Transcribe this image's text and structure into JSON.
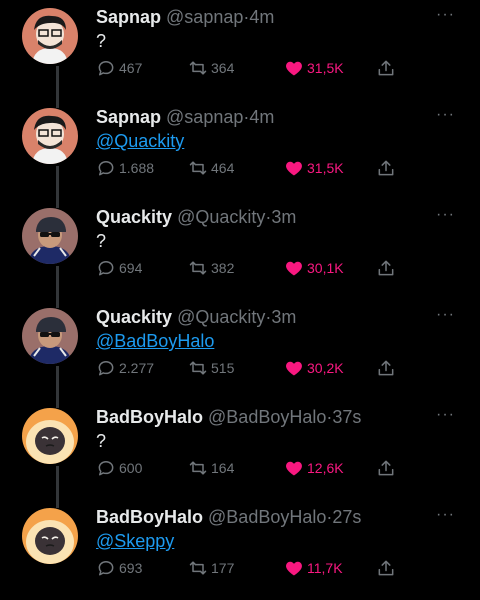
{
  "tweets": [
    {
      "name": "Sapnap",
      "handle": "@sapnap",
      "separator": "·",
      "time": "4m",
      "text": "?",
      "text_is_mention": false,
      "replies": "467",
      "retweets": "364",
      "likes": "31,5K",
      "avatar": "sapnap-avatar"
    },
    {
      "name": "Sapnap",
      "handle": "@sapnap",
      "separator": "·",
      "time": "4m",
      "text": "@Quackity",
      "text_is_mention": true,
      "replies": "1.688",
      "retweets": "464",
      "likes": "31,5K",
      "avatar": "sapnap-avatar"
    },
    {
      "name": "Quackity",
      "handle": "@Quackity",
      "separator": "·",
      "time": "3m",
      "text": "?",
      "text_is_mention": false,
      "replies": "694",
      "retweets": "382",
      "likes": "30,1K",
      "avatar": "quackity-avatar"
    },
    {
      "name": "Quackity",
      "handle": "@Quackity",
      "separator": "·",
      "time": "3m",
      "text": "@BadBoyHalo",
      "text_is_mention": true,
      "replies": "2.277",
      "retweets": "515",
      "likes": "30,2K",
      "avatar": "quackity-avatar"
    },
    {
      "name": "BadBoyHalo",
      "handle": "@BadBoyHalo",
      "separator": "·",
      "time": "37s",
      "text": "?",
      "text_is_mention": false,
      "replies": "600",
      "retweets": "164",
      "likes": "12,6K",
      "avatar": "badboyhalo-avatar"
    },
    {
      "name": "BadBoyHalo",
      "handle": "@BadBoyHalo",
      "separator": "·",
      "time": "27s",
      "text": "@Skeppy",
      "text_is_mention": true,
      "replies": "693",
      "retweets": "177",
      "likes": "11,7K",
      "avatar": "badboyhalo-avatar"
    }
  ],
  "more_glyph": "···",
  "colors": {
    "background": "#000000",
    "text": "#e7e9ea",
    "muted": "#71767b",
    "mention": "#1d9bf0",
    "like": "#f91880",
    "thread_line": "#333639"
  },
  "icons": {
    "reply": "reply-bubble-icon",
    "retweet": "retweet-icon",
    "like": "heart-icon",
    "share": "share-upload-icon",
    "more": "more-dots-icon"
  }
}
